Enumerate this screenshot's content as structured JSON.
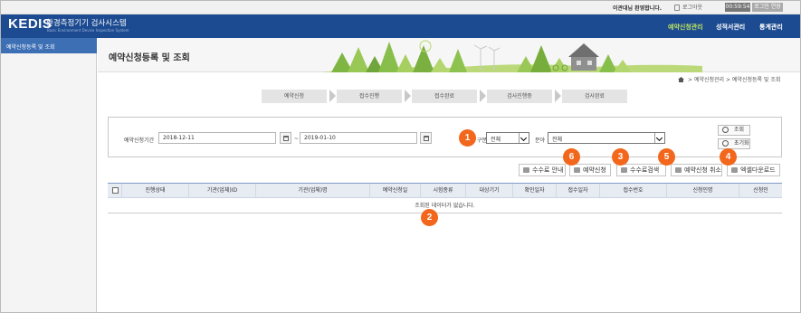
{
  "top_bar": {
    "welcome": "이관대님 환영합니다.",
    "logout": "로그아웃",
    "timer": "00:59:54",
    "extend": "로그인 연장"
  },
  "header": {
    "logo": "KEDIS",
    "system_name_kr": "환경측정기기 검사시스템",
    "system_name_en": "Basic Environment Device Inspection System",
    "nav": [
      {
        "label": "예약신청관리",
        "active": true
      },
      {
        "label": "성적서관리",
        "active": false
      },
      {
        "label": "통계관리",
        "active": false
      }
    ]
  },
  "sidebar": {
    "items": [
      {
        "label": "예약신청등록 및 조회",
        "active": true
      }
    ]
  },
  "page": {
    "title": "예약신청등록 및 조회",
    "breadcrumb": [
      "예약신청관리",
      "예약신청등록 및 조회"
    ]
  },
  "steps": [
    "예약신청",
    "접수진행",
    "접수완료",
    "검사진행중",
    "검사완료"
  ],
  "search": {
    "period_label": "예약신청기간",
    "date_from": "2018-12-11",
    "date_sep": "~",
    "date_to": "2019-01-10",
    "type_label": "구분",
    "type_value": "전체",
    "field_label": "분야",
    "field_value": "전체",
    "search_button": "조회",
    "reset_button": "초기화"
  },
  "actions": [
    "수수료 안내",
    "예약신청",
    "수수료검색",
    "예약신청 취소",
    "엑셀다운로드"
  ],
  "table": {
    "columns": [
      "진행상태",
      "기관(업체)ID",
      "기관(업체)명",
      "예약신청일",
      "시험종류",
      "대상기기",
      "확인일자",
      "접수일자",
      "접수번호",
      "신청인명",
      "신청인"
    ],
    "empty_message": "조회된 데이터가 없습니다."
  },
  "annotations": [
    "1",
    "2",
    "3",
    "4",
    "5",
    "6"
  ],
  "colors": {
    "header": "#1d4b91",
    "accent": "#b8e060",
    "badge": "#f2671c",
    "sidebar_active": "#3d6fb5"
  }
}
